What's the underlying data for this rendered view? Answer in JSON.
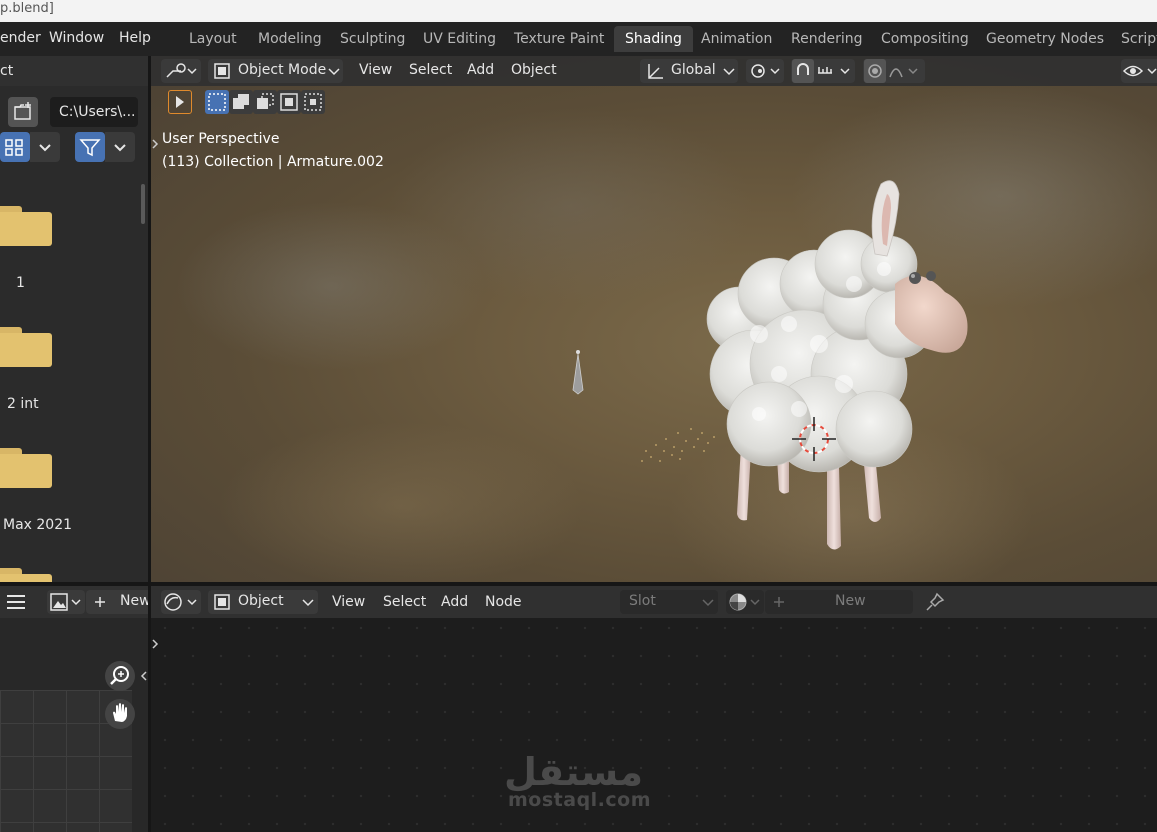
{
  "window": {
    "title": "p.blend]"
  },
  "menu": [
    "ender",
    "Window",
    "Help"
  ],
  "workspace_tabs": [
    {
      "label": "Layout",
      "active": false
    },
    {
      "label": "Modeling",
      "active": false
    },
    {
      "label": "Sculpting",
      "active": false
    },
    {
      "label": "UV Editing",
      "active": false
    },
    {
      "label": "Texture Paint",
      "active": false
    },
    {
      "label": "Shading",
      "active": true
    },
    {
      "label": "Animation",
      "active": false
    },
    {
      "label": "Rendering",
      "active": false
    },
    {
      "label": "Compositing",
      "active": false
    },
    {
      "label": "Geometry Nodes",
      "active": false
    },
    {
      "label": "Script",
      "active": false
    }
  ],
  "file_browser": {
    "header_label": "ct",
    "path": "C:\\Users\\...",
    "folders": [
      {
        "label": "1"
      },
      {
        "label": "2 int"
      },
      {
        "label": "Max 2021"
      },
      {
        "label": ""
      }
    ]
  },
  "viewport": {
    "mode": "Object Mode",
    "menus": [
      "View",
      "Select",
      "Add",
      "Object"
    ],
    "orientation": "Global",
    "perspective_label": "User Perspective",
    "collection_label": "(113) Collection | Armature.002"
  },
  "image_editor": {
    "new_label": "New"
  },
  "node_editor": {
    "object_label": "Object",
    "menus": [
      "View",
      "Select",
      "Add",
      "Node"
    ],
    "slot_label": "Slot",
    "new_label": "New"
  },
  "watermark": {
    "arabic": "مستقل",
    "latin": "mostaql.com"
  },
  "colors": {
    "accent": "#4772b3",
    "folder": "#e3c26f",
    "active_tab": "#3d3d3d"
  }
}
